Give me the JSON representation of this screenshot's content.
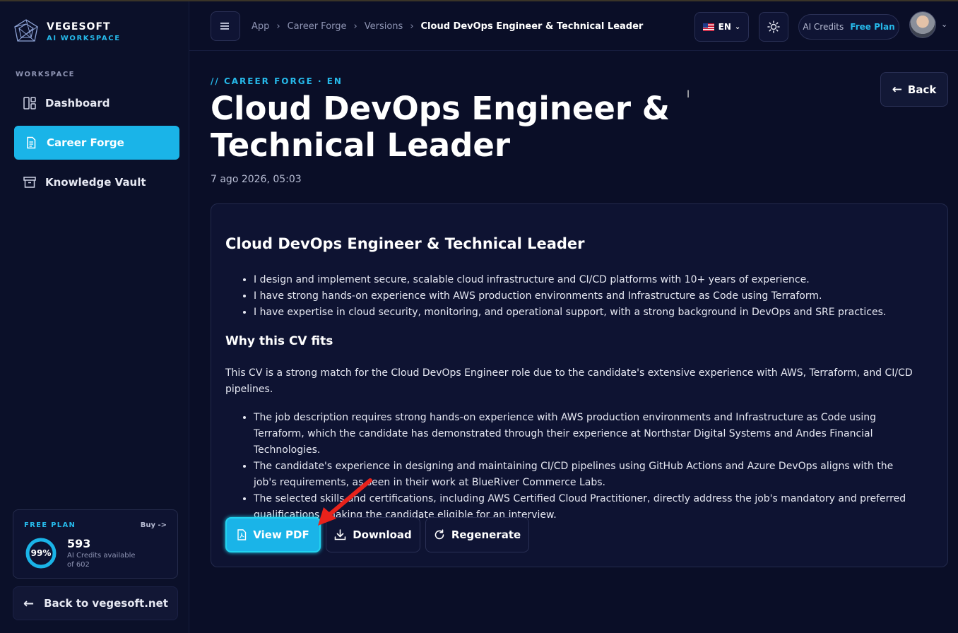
{
  "brand": {
    "name": "VEGESOFT",
    "subtitle": "AI WORKSPACE"
  },
  "sidebar": {
    "section_label": "WORKSPACE",
    "items": [
      {
        "label": "Dashboard",
        "icon": "dashboard-icon",
        "active": false
      },
      {
        "label": "Career Forge",
        "icon": "document-icon",
        "active": true
      },
      {
        "label": "Knowledge Vault",
        "icon": "archive-icon",
        "active": false
      }
    ],
    "plan": {
      "label": "FREE PLAN",
      "buy": "Buy ->",
      "percent": "99%",
      "percent_value": 0.99,
      "credits": "593",
      "credits_line1": "AI Credits available",
      "credits_line2": "of 602"
    },
    "back_link": "Back to vegesoft.net"
  },
  "header": {
    "breadcrumb": [
      "App",
      "Career Forge",
      "Versions",
      "Cloud DevOps Engineer & Technical Leader"
    ],
    "language": "EN",
    "credits_label": "AI Credits",
    "plan_label": "Free Plan"
  },
  "main": {
    "eyebrow": "// CAREER FORGE · EN",
    "title": "Cloud DevOps Engineer & Technical Leader",
    "date": "7 ago 2026, 05:03",
    "back_label": "Back",
    "card": {
      "heading": "Cloud DevOps Engineer & Technical Leader",
      "summary_points": [
        "I design and implement secure, scalable cloud infrastructure and CI/CD platforms with 10+ years of experience.",
        "I have strong hands-on experience with AWS production environments and Infrastructure as Code using Terraform.",
        "I have expertise in cloud security, monitoring, and operational support, with a strong background in DevOps and SRE practices."
      ],
      "why_heading": "Why this CV fits",
      "why_paragraph": "This CV is a strong match for the Cloud DevOps Engineer role due to the candidate's extensive experience with AWS, Terraform, and CI/CD pipelines.",
      "why_points": [
        "The job description requires strong hands-on experience with AWS production environments and Infrastructure as Code using Terraform, which the candidate has demonstrated through their experience at Northstar Digital Systems and Andes Financial Technologies.",
        "The candidate's experience in designing and maintaining CI/CD pipelines using GitHub Actions and Azure DevOps aligns with the job's requirements, as seen in their work at BlueRiver Commerce Labs.",
        "The selected skills and certifications, including AWS Certified Cloud Practitioner, directly address the job's mandatory and preferred qualifications, making the candidate eligible for an interview."
      ],
      "actions": {
        "view_pdf": "View PDF",
        "download": "Download",
        "regenerate": "Regenerate"
      }
    }
  },
  "colors": {
    "accent": "#1ab4e8",
    "background": "#0a0e27",
    "card": "#0e1332",
    "annotation": "#e8221b"
  }
}
